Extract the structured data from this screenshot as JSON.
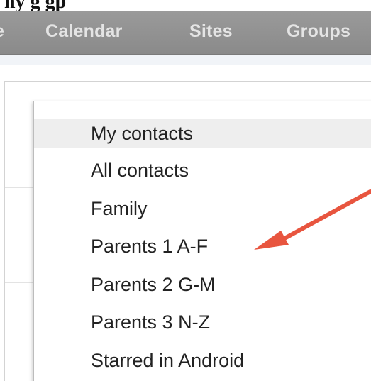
{
  "heading": "ny g  gp",
  "nav": {
    "cut_item": "e",
    "calendar": "Calendar",
    "sites": "Sites",
    "groups": "Groups"
  },
  "menu": {
    "items": [
      {
        "label": "My contacts"
      },
      {
        "label": "All contacts"
      },
      {
        "label": "Family"
      },
      {
        "label": "Parents 1 A-F"
      },
      {
        "label": "Parents 2 G-M"
      },
      {
        "label": "Parents 3 N-Z"
      },
      {
        "label": "Starred in Android"
      }
    ]
  },
  "colors": {
    "arrow": "#e8553f",
    "nav_bar": "#8f8f8f",
    "nav_text": "#e4e4e4",
    "highlight": "#eeeeee"
  }
}
